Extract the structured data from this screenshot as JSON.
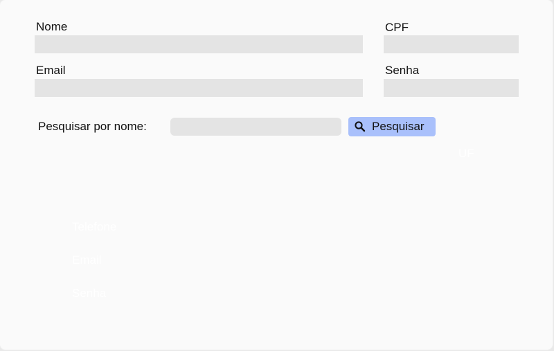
{
  "form": {
    "nome_label": "Nome",
    "nome_value": "",
    "cpf_label": "CPF",
    "cpf_value": "",
    "email_label": "Email",
    "email_value": "",
    "senha_label": "Senha",
    "senha_value": ""
  },
  "search": {
    "label": "Pesquisar por nome:",
    "value": "",
    "button_label": "Pesquisar",
    "button_icon": "search-icon",
    "button_color": "#a9c0fb"
  },
  "ghost_labels": {
    "uf": "UF",
    "telefone": "Telefone",
    "email": "Email",
    "senha": "Senha"
  },
  "colors": {
    "background": "#fafafa",
    "field": "#e4e4e4",
    "text": "#111111"
  }
}
